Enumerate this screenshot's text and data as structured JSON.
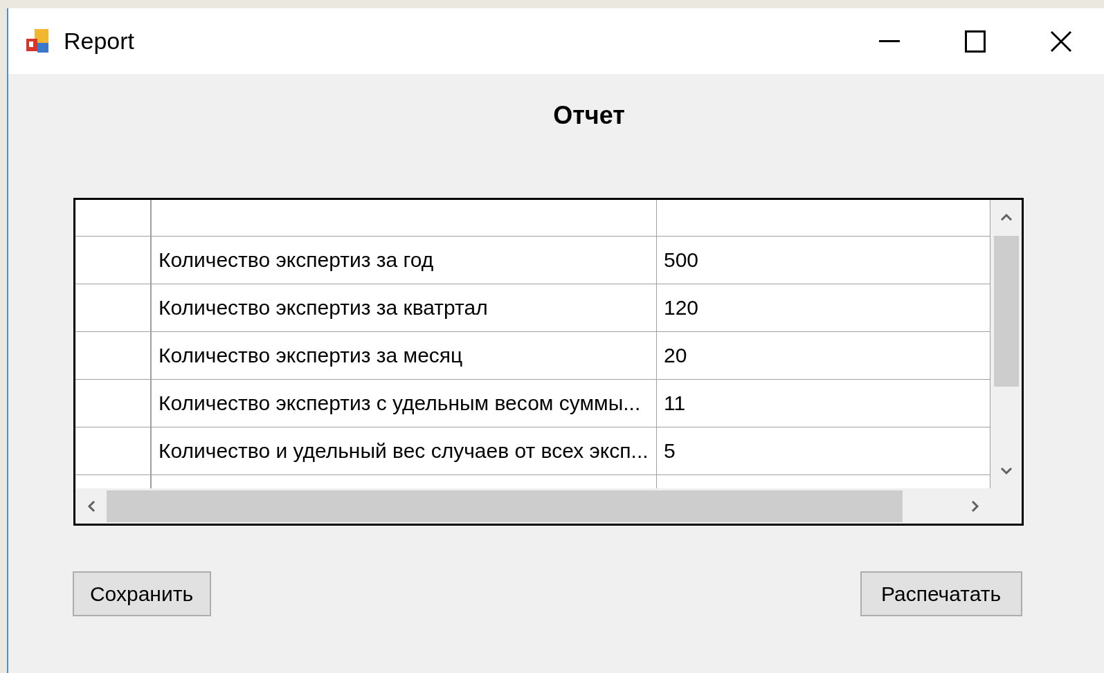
{
  "window": {
    "title": "Report"
  },
  "heading": "Отчет",
  "table": {
    "rows": [
      {
        "label": "Количество экспертиз за год",
        "value": "500"
      },
      {
        "label": "Количество экспертиз за кватртал",
        "value": "120"
      },
      {
        "label": "Количество экспертиз за месяц",
        "value": "20"
      },
      {
        "label": "Количество экспертиз с удельным весом суммы...",
        "value": "11"
      },
      {
        "label": "Количество и удельный вес случаев от всех эксп...",
        "value": "5"
      }
    ]
  },
  "buttons": [
    {
      "label": "Сохранить"
    },
    {
      "label": "Распечатать"
    }
  ]
}
